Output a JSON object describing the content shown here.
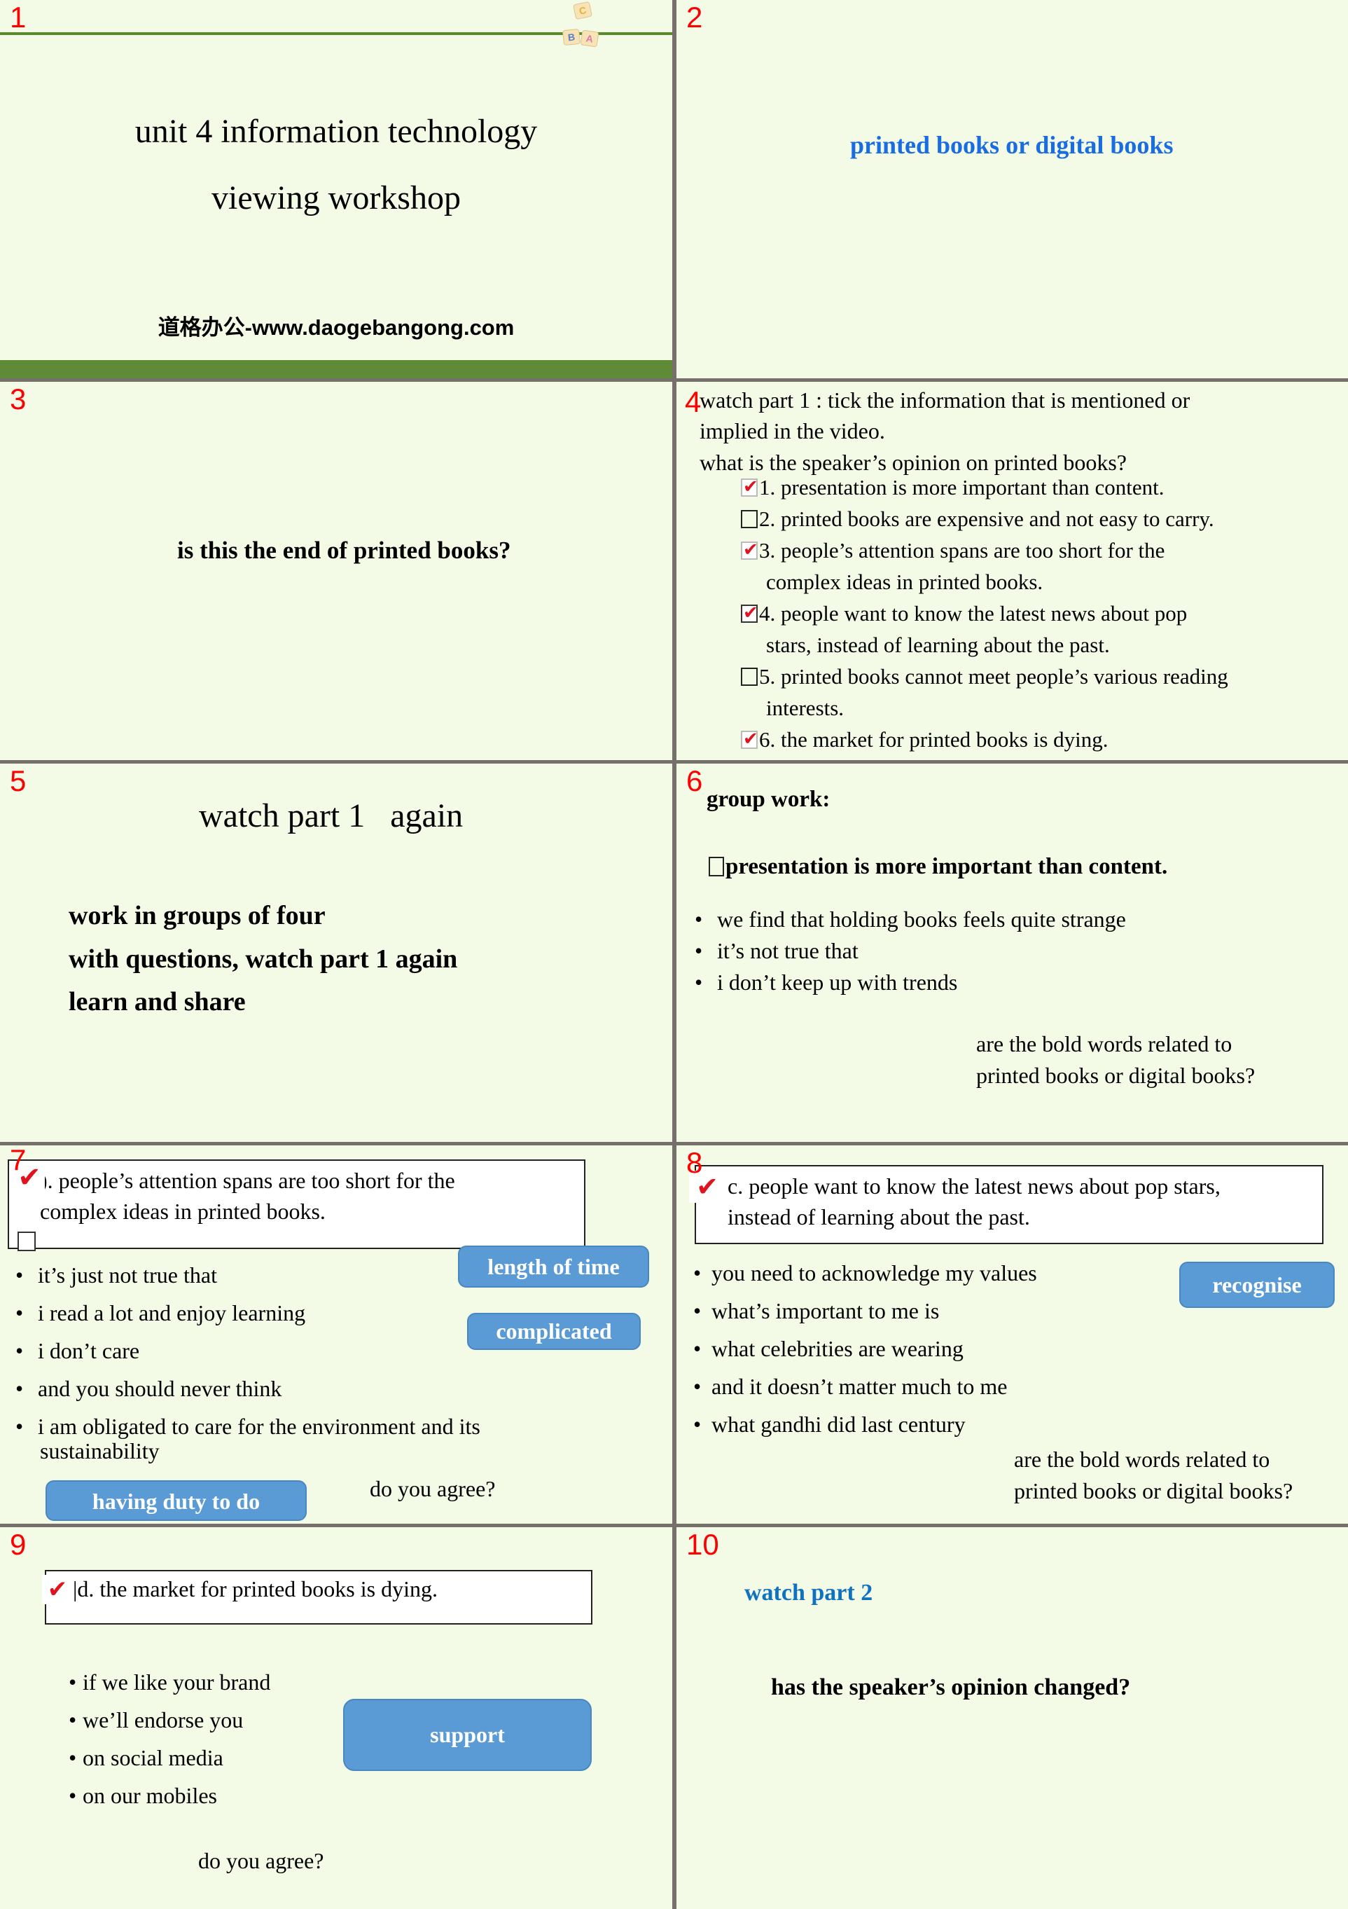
{
  "slides": [
    {
      "number": "1",
      "title_line1": "unit 4 information technology",
      "title_line2": "viewing workshop",
      "website": "道格办公-www.daogebangong.com",
      "decoration": {
        "icon": "abc-blocks-icon",
        "blocks": [
          "C",
          "B",
          "A"
        ]
      },
      "colors": {
        "accent_green": "#5f8a37"
      }
    },
    {
      "number": "2",
      "heading": "printed books or digital books",
      "colors": {
        "heading": "#1a6de0"
      }
    },
    {
      "number": "3",
      "question": "is this the end of printed books?"
    },
    {
      "number": "4",
      "instruction_line1": "watch part 1 : tick the information that is mentioned or",
      "instruction_line2": "implied in the video.",
      "question": "what is the speaker’s opinion on printed books?",
      "options": [
        {
          "text": "1. presentation is more important than content.",
          "checked": true
        },
        {
          "text": "2. printed books are expensive and not easy to carry.",
          "checked": false
        },
        {
          "text": "3. people’s attention spans are too short for the",
          "continuation": "complex ideas in printed books.",
          "checked": true
        },
        {
          "text": "4. people want to know the latest news about pop",
          "continuation": "stars, instead of learning about the past.",
          "checked": true
        },
        {
          "text": "5. printed books cannot meet people’s various reading",
          "continuation": "interests.",
          "checked": false
        },
        {
          "text": "6. the market for printed books is dying.",
          "checked": true
        }
      ]
    },
    {
      "number": "5",
      "title": "watch part 1   again",
      "steps": [
        "work in groups of four",
        "with questions, watch part 1 again",
        "learn and share"
      ]
    },
    {
      "number": "6",
      "heading": "group work:",
      "statement": "presentation is more important than content.",
      "bullets": [
        "we find that holding books feels quite strange",
        "it’s not true that",
        "i don’t keep up with trends"
      ],
      "question_line1": "are the bold words related to",
      "question_line2": "printed books or digital books?"
    },
    {
      "number": "7",
      "statement_line1": "b. people’s attention spans are too short for the",
      "statement_visible_line1": "). people’s attention spans are too short for the",
      "statement_line2": "complex ideas in printed books.",
      "bullets": [
        "it’s just not true that",
        "i read a lot and enjoy learning",
        "i don’t care",
        "and you should never think",
        "i am obligated to care for the environment and its"
      ],
      "bullet5_continuation": "sustainability",
      "labels": [
        "length of time",
        "complicated",
        "having duty to do"
      ],
      "question": "do you agree?",
      "colors": {
        "label_bg": "#5b9bd5"
      }
    },
    {
      "number": "8",
      "statement_line1": "c. people want to know the latest news about pop stars,",
      "statement_line2": "instead of learning about the past.",
      "bullets": [
        "you need to acknowledge my values",
        "what’s important to me is",
        "what celebrities are wearing",
        "and it doesn’t matter much to me",
        "what gandhi did last century"
      ],
      "label": "recognise",
      "question_line1": "are the bold words related to",
      "question_line2": "printed books or digital books?"
    },
    {
      "number": "9",
      "statement": "|d. the market for printed books is dying.",
      "bullets": [
        "if we like your brand",
        "we’ll endorse you",
        "on social media",
        "on our mobiles"
      ],
      "label": "support",
      "question": "do you agree?"
    },
    {
      "number": "10",
      "heading": "watch part 2",
      "question": "has the speaker’s opinion changed?",
      "colors": {
        "heading": "#0f72c0"
      }
    }
  ],
  "icons": {
    "tick": "✔",
    "checked_checkbox": "checkbox-checked-icon",
    "empty_checkbox": "checkbox-empty-icon"
  }
}
